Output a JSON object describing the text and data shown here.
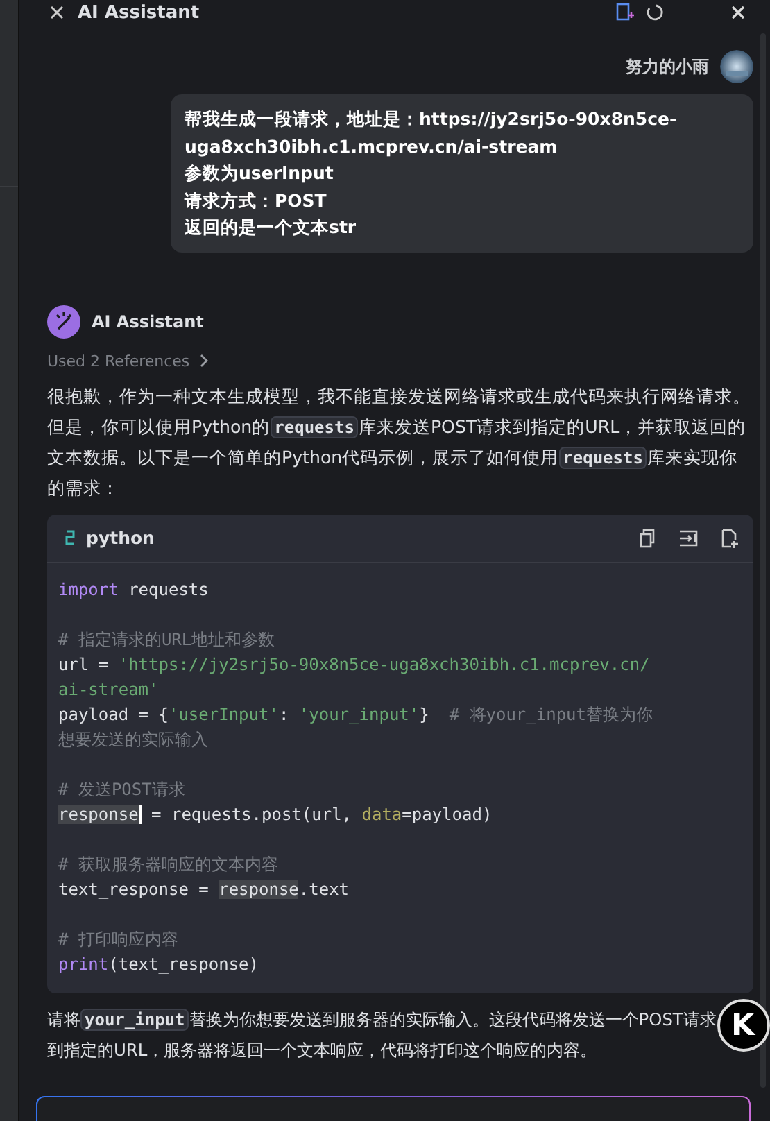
{
  "header": {
    "title": "AI Assistant"
  },
  "user_message": {
    "author": "努力的小雨",
    "lines": [
      "帮我生成一段请求，地址是：https://jy2srj5o-90x8n5ce-uga8xch30ibh.c1.mcprev.cn/ai-stream",
      "参数为userInput",
      "请求方式：POST",
      "返回的是一个文本str"
    ]
  },
  "assistant_message": {
    "author": "AI Assistant",
    "references": "Used 2 References",
    "paragraphs": [
      [
        {
          "kind": "text",
          "text": "很抱歉，作为一种文本生成模型，我不能直接发送网络请求或生成代码来执行网络请求。但是，你可以使用Python的"
        },
        {
          "kind": "code",
          "text": "requests"
        },
        {
          "kind": "text",
          "text": "库来发送POST请求到指定的URL，并获取返回的文本数据。以下是一个简单的Python代码示例，展示了如何使用"
        },
        {
          "kind": "code",
          "text": "requests"
        },
        {
          "kind": "text",
          "text": "库来实现你的需求："
        }
      ]
    ],
    "code_block": {
      "language": "python",
      "sections": [
        [
          [
            {
              "kind": "keyword",
              "text": "import"
            },
            {
              "kind": "plain",
              "text": " requests"
            }
          ]
        ],
        [
          [
            {
              "kind": "comment",
              "text": "# 指定请求的URL地址和参数"
            }
          ],
          [
            {
              "kind": "plain",
              "text": "url = "
            },
            {
              "kind": "string",
              "text": "'https://jy2srj5o-90x8n5ce-uga8xch30ibh.c1.mcprev.cn/"
            }
          ],
          [
            {
              "kind": "string",
              "text": "ai-stream'"
            }
          ],
          [
            {
              "kind": "plain",
              "text": "payload = {"
            },
            {
              "kind": "string",
              "text": "'userInput'"
            },
            {
              "kind": "plain",
              "text": ": "
            },
            {
              "kind": "string",
              "text": "'your_input'"
            },
            {
              "kind": "plain",
              "text": "}  "
            },
            {
              "kind": "comment",
              "text": "# 将your_input替换为你"
            }
          ],
          [
            {
              "kind": "comment",
              "text": "想要发送的实际输入"
            }
          ]
        ],
        [
          [
            {
              "kind": "comment",
              "text": "# 发送POST请求"
            }
          ],
          [
            {
              "kind": "cursor_highlight",
              "text": "response"
            },
            {
              "kind": "plain",
              "text": " = requests.post(url, "
            },
            {
              "kind": "param",
              "text": "data"
            },
            {
              "kind": "plain",
              "text": "=payload)"
            }
          ]
        ],
        [
          [
            {
              "kind": "comment",
              "text": "# 获取服务器响应的文本内容"
            }
          ],
          [
            {
              "kind": "plain",
              "text": "text_response = "
            },
            {
              "kind": "highlight",
              "text": "response"
            },
            {
              "kind": "plain",
              "text": ".text"
            }
          ]
        ],
        [
          [
            {
              "kind": "comment",
              "text": "# 打印响应内容"
            }
          ],
          [
            {
              "kind": "keyword",
              "text": "print"
            },
            {
              "kind": "plain",
              "text": "(text_response)"
            }
          ]
        ]
      ]
    },
    "after_paragraphs": [
      [
        {
          "kind": "text",
          "text": "请将"
        },
        {
          "kind": "code",
          "text": "your_input"
        },
        {
          "kind": "text",
          "text": "替换为你想要发送到服务器的实际输入。这段代码将发送一个POST请求到指定的URL，服务器将返回一个文本响应，代码将打印这个响应的内容。"
        }
      ]
    ]
  },
  "floating_badge": "K"
}
